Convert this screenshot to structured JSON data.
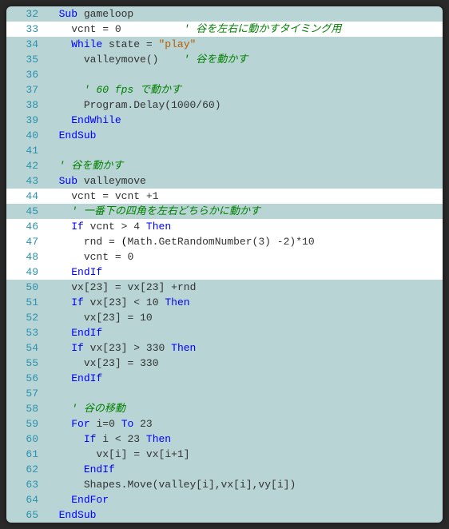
{
  "lines": [
    {
      "n": 32,
      "hl": false,
      "tokens": [
        {
          "t": "  ",
          "c": "plain"
        },
        {
          "t": "Sub",
          "c": "kw"
        },
        {
          "t": " ",
          "c": "plain"
        },
        {
          "t": "gameloop",
          "c": "ident"
        }
      ]
    },
    {
      "n": 33,
      "hl": true,
      "tokens": [
        {
          "t": "    ",
          "c": "plain"
        },
        {
          "t": "vcnt",
          "c": "ident"
        },
        {
          "t": " ",
          "c": "plain"
        },
        {
          "t": "=",
          "c": "op"
        },
        {
          "t": " ",
          "c": "plain"
        },
        {
          "t": "0",
          "c": "num"
        },
        {
          "t": "          ",
          "c": "plain"
        },
        {
          "t": "' 谷を左右に動かすタイミング用",
          "c": "comment"
        }
      ]
    },
    {
      "n": 34,
      "hl": false,
      "tokens": [
        {
          "t": "    ",
          "c": "plain"
        },
        {
          "t": "While",
          "c": "kw"
        },
        {
          "t": " ",
          "c": "plain"
        },
        {
          "t": "state",
          "c": "ident"
        },
        {
          "t": " ",
          "c": "plain"
        },
        {
          "t": "=",
          "c": "op"
        },
        {
          "t": " ",
          "c": "plain"
        },
        {
          "t": "\"play\"",
          "c": "str"
        }
      ]
    },
    {
      "n": 35,
      "hl": false,
      "tokens": [
        {
          "t": "      ",
          "c": "plain"
        },
        {
          "t": "valleymove",
          "c": "ident"
        },
        {
          "t": "()",
          "c": "op"
        },
        {
          "t": "    ",
          "c": "plain"
        },
        {
          "t": "' 谷を動かす",
          "c": "comment"
        }
      ]
    },
    {
      "n": 36,
      "hl": false,
      "tokens": []
    },
    {
      "n": 37,
      "hl": false,
      "tokens": [
        {
          "t": "      ",
          "c": "plain"
        },
        {
          "t": "' 60 fps で動かす",
          "c": "comment"
        }
      ]
    },
    {
      "n": 38,
      "hl": false,
      "tokens": [
        {
          "t": "      ",
          "c": "plain"
        },
        {
          "t": "Program",
          "c": "ident"
        },
        {
          "t": ".",
          "c": "op"
        },
        {
          "t": "Delay",
          "c": "ident"
        },
        {
          "t": "(",
          "c": "op"
        },
        {
          "t": "1000",
          "c": "num"
        },
        {
          "t": "/",
          "c": "op"
        },
        {
          "t": "60",
          "c": "num"
        },
        {
          "t": ")",
          "c": "op"
        }
      ]
    },
    {
      "n": 39,
      "hl": false,
      "tokens": [
        {
          "t": "    ",
          "c": "plain"
        },
        {
          "t": "EndWhile",
          "c": "kw"
        }
      ]
    },
    {
      "n": 40,
      "hl": false,
      "tokens": [
        {
          "t": "  ",
          "c": "plain"
        },
        {
          "t": "EndSub",
          "c": "kw"
        }
      ]
    },
    {
      "n": 41,
      "hl": false,
      "tokens": []
    },
    {
      "n": 42,
      "hl": false,
      "tokens": [
        {
          "t": "  ",
          "c": "plain"
        },
        {
          "t": "' 谷を動かす",
          "c": "comment"
        }
      ]
    },
    {
      "n": 43,
      "hl": false,
      "tokens": [
        {
          "t": "  ",
          "c": "plain"
        },
        {
          "t": "Sub",
          "c": "kw"
        },
        {
          "t": " ",
          "c": "plain"
        },
        {
          "t": "valleymove",
          "c": "ident"
        }
      ]
    },
    {
      "n": 44,
      "hl": true,
      "tokens": [
        {
          "t": "    ",
          "c": "plain"
        },
        {
          "t": "vcnt",
          "c": "ident"
        },
        {
          "t": " ",
          "c": "plain"
        },
        {
          "t": "=",
          "c": "op"
        },
        {
          "t": " ",
          "c": "plain"
        },
        {
          "t": "vcnt",
          "c": "ident"
        },
        {
          "t": " ",
          "c": "plain"
        },
        {
          "t": "+",
          "c": "op"
        },
        {
          "t": "1",
          "c": "num"
        }
      ]
    },
    {
      "n": 45,
      "hl": false,
      "tokens": [
        {
          "t": "    ",
          "c": "plain"
        },
        {
          "t": "' 一番下の四角を左右どちらかに動かす",
          "c": "comment"
        }
      ]
    },
    {
      "n": 46,
      "hl": true,
      "tokens": [
        {
          "t": "    ",
          "c": "plain"
        },
        {
          "t": "If",
          "c": "kw"
        },
        {
          "t": " ",
          "c": "plain"
        },
        {
          "t": "vcnt",
          "c": "ident"
        },
        {
          "t": " ",
          "c": "plain"
        },
        {
          "t": ">",
          "c": "op"
        },
        {
          "t": " ",
          "c": "plain"
        },
        {
          "t": "4",
          "c": "num"
        },
        {
          "t": " ",
          "c": "plain"
        },
        {
          "t": "Then",
          "c": "kw"
        }
      ]
    },
    {
      "n": 47,
      "hl": true,
      "tokens": [
        {
          "t": "      ",
          "c": "plain"
        },
        {
          "t": "rnd",
          "c": "ident"
        },
        {
          "t": " ",
          "c": "plain"
        },
        {
          "t": "=",
          "c": "op"
        },
        {
          "t": " (",
          "c": "plain"
        },
        {
          "t": "Math",
          "c": "ident"
        },
        {
          "t": ".",
          "c": "op"
        },
        {
          "t": "GetRandomNumber",
          "c": "ident"
        },
        {
          "t": "(",
          "c": "op"
        },
        {
          "t": "3",
          "c": "num"
        },
        {
          "t": ")",
          "c": "op"
        },
        {
          "t": " ",
          "c": "plain"
        },
        {
          "t": "-",
          "c": "op"
        },
        {
          "t": "2",
          "c": "num"
        },
        {
          "t": ")",
          "c": "op"
        },
        {
          "t": "*",
          "c": "op"
        },
        {
          "t": "10",
          "c": "num"
        }
      ]
    },
    {
      "n": 48,
      "hl": true,
      "tokens": [
        {
          "t": "      ",
          "c": "plain"
        },
        {
          "t": "vcnt",
          "c": "ident"
        },
        {
          "t": " ",
          "c": "plain"
        },
        {
          "t": "=",
          "c": "op"
        },
        {
          "t": " ",
          "c": "plain"
        },
        {
          "t": "0",
          "c": "num"
        }
      ]
    },
    {
      "n": 49,
      "hl": true,
      "tokens": [
        {
          "t": "    ",
          "c": "plain"
        },
        {
          "t": "EndIf",
          "c": "kw"
        }
      ]
    },
    {
      "n": 50,
      "hl": false,
      "tokens": [
        {
          "t": "    ",
          "c": "plain"
        },
        {
          "t": "vx",
          "c": "ident"
        },
        {
          "t": "[",
          "c": "op"
        },
        {
          "t": "23",
          "c": "num"
        },
        {
          "t": "]",
          "c": "op"
        },
        {
          "t": " ",
          "c": "plain"
        },
        {
          "t": "=",
          "c": "op"
        },
        {
          "t": " ",
          "c": "plain"
        },
        {
          "t": "vx",
          "c": "ident"
        },
        {
          "t": "[",
          "c": "op"
        },
        {
          "t": "23",
          "c": "num"
        },
        {
          "t": "]",
          "c": "op"
        },
        {
          "t": " ",
          "c": "plain"
        },
        {
          "t": "+",
          "c": "op"
        },
        {
          "t": "rnd",
          "c": "ident"
        }
      ]
    },
    {
      "n": 51,
      "hl": false,
      "tokens": [
        {
          "t": "    ",
          "c": "plain"
        },
        {
          "t": "If",
          "c": "kw"
        },
        {
          "t": " ",
          "c": "plain"
        },
        {
          "t": "vx",
          "c": "ident"
        },
        {
          "t": "[",
          "c": "op"
        },
        {
          "t": "23",
          "c": "num"
        },
        {
          "t": "]",
          "c": "op"
        },
        {
          "t": " ",
          "c": "plain"
        },
        {
          "t": "<",
          "c": "op"
        },
        {
          "t": " ",
          "c": "plain"
        },
        {
          "t": "10",
          "c": "num"
        },
        {
          "t": " ",
          "c": "plain"
        },
        {
          "t": "Then",
          "c": "kw"
        }
      ]
    },
    {
      "n": 52,
      "hl": false,
      "tokens": [
        {
          "t": "      ",
          "c": "plain"
        },
        {
          "t": "vx",
          "c": "ident"
        },
        {
          "t": "[",
          "c": "op"
        },
        {
          "t": "23",
          "c": "num"
        },
        {
          "t": "]",
          "c": "op"
        },
        {
          "t": " ",
          "c": "plain"
        },
        {
          "t": "=",
          "c": "op"
        },
        {
          "t": " ",
          "c": "plain"
        },
        {
          "t": "10",
          "c": "num"
        }
      ]
    },
    {
      "n": 53,
      "hl": false,
      "tokens": [
        {
          "t": "    ",
          "c": "plain"
        },
        {
          "t": "EndIf",
          "c": "kw"
        }
      ]
    },
    {
      "n": 54,
      "hl": false,
      "tokens": [
        {
          "t": "    ",
          "c": "plain"
        },
        {
          "t": "If",
          "c": "kw"
        },
        {
          "t": " ",
          "c": "plain"
        },
        {
          "t": "vx",
          "c": "ident"
        },
        {
          "t": "[",
          "c": "op"
        },
        {
          "t": "23",
          "c": "num"
        },
        {
          "t": "]",
          "c": "op"
        },
        {
          "t": " ",
          "c": "plain"
        },
        {
          "t": ">",
          "c": "op"
        },
        {
          "t": " ",
          "c": "plain"
        },
        {
          "t": "330",
          "c": "num"
        },
        {
          "t": " ",
          "c": "plain"
        },
        {
          "t": "Then",
          "c": "kw"
        }
      ]
    },
    {
      "n": 55,
      "hl": false,
      "tokens": [
        {
          "t": "      ",
          "c": "plain"
        },
        {
          "t": "vx",
          "c": "ident"
        },
        {
          "t": "[",
          "c": "op"
        },
        {
          "t": "23",
          "c": "num"
        },
        {
          "t": "]",
          "c": "op"
        },
        {
          "t": " ",
          "c": "plain"
        },
        {
          "t": "=",
          "c": "op"
        },
        {
          "t": " ",
          "c": "plain"
        },
        {
          "t": "330",
          "c": "num"
        }
      ]
    },
    {
      "n": 56,
      "hl": false,
      "tokens": [
        {
          "t": "    ",
          "c": "plain"
        },
        {
          "t": "EndIf",
          "c": "kw"
        }
      ]
    },
    {
      "n": 57,
      "hl": false,
      "tokens": []
    },
    {
      "n": 58,
      "hl": false,
      "tokens": [
        {
          "t": "    ",
          "c": "plain"
        },
        {
          "t": "' 谷の移動",
          "c": "comment"
        }
      ]
    },
    {
      "n": 59,
      "hl": false,
      "tokens": [
        {
          "t": "    ",
          "c": "plain"
        },
        {
          "t": "For",
          "c": "kw"
        },
        {
          "t": " ",
          "c": "plain"
        },
        {
          "t": "i",
          "c": "ident"
        },
        {
          "t": "=",
          "c": "op"
        },
        {
          "t": "0",
          "c": "num"
        },
        {
          "t": " ",
          "c": "plain"
        },
        {
          "t": "To",
          "c": "kw"
        },
        {
          "t": " ",
          "c": "plain"
        },
        {
          "t": "23",
          "c": "num"
        }
      ]
    },
    {
      "n": 60,
      "hl": false,
      "tokens": [
        {
          "t": "      ",
          "c": "plain"
        },
        {
          "t": "If",
          "c": "kw"
        },
        {
          "t": " ",
          "c": "plain"
        },
        {
          "t": "i",
          "c": "ident"
        },
        {
          "t": " ",
          "c": "plain"
        },
        {
          "t": "<",
          "c": "op"
        },
        {
          "t": " ",
          "c": "plain"
        },
        {
          "t": "23",
          "c": "num"
        },
        {
          "t": " ",
          "c": "plain"
        },
        {
          "t": "Then",
          "c": "kw"
        }
      ]
    },
    {
      "n": 61,
      "hl": false,
      "tokens": [
        {
          "t": "        ",
          "c": "plain"
        },
        {
          "t": "vx",
          "c": "ident"
        },
        {
          "t": "[",
          "c": "op"
        },
        {
          "t": "i",
          "c": "ident"
        },
        {
          "t": "]",
          "c": "op"
        },
        {
          "t": " ",
          "c": "plain"
        },
        {
          "t": "=",
          "c": "op"
        },
        {
          "t": " ",
          "c": "plain"
        },
        {
          "t": "vx",
          "c": "ident"
        },
        {
          "t": "[",
          "c": "op"
        },
        {
          "t": "i",
          "c": "ident"
        },
        {
          "t": "+",
          "c": "op"
        },
        {
          "t": "1",
          "c": "num"
        },
        {
          "t": "]",
          "c": "op"
        }
      ]
    },
    {
      "n": 62,
      "hl": false,
      "tokens": [
        {
          "t": "      ",
          "c": "plain"
        },
        {
          "t": "EndIf",
          "c": "kw"
        }
      ]
    },
    {
      "n": 63,
      "hl": false,
      "tokens": [
        {
          "t": "      ",
          "c": "plain"
        },
        {
          "t": "Shapes",
          "c": "ident"
        },
        {
          "t": ".",
          "c": "op"
        },
        {
          "t": "Move",
          "c": "ident"
        },
        {
          "t": "(",
          "c": "op"
        },
        {
          "t": "valley",
          "c": "ident"
        },
        {
          "t": "[",
          "c": "op"
        },
        {
          "t": "i",
          "c": "ident"
        },
        {
          "t": "]",
          "c": "op"
        },
        {
          "t": ",",
          "c": "op"
        },
        {
          "t": "vx",
          "c": "ident"
        },
        {
          "t": "[",
          "c": "op"
        },
        {
          "t": "i",
          "c": "ident"
        },
        {
          "t": "]",
          "c": "op"
        },
        {
          "t": ",",
          "c": "op"
        },
        {
          "t": "vy",
          "c": "ident"
        },
        {
          "t": "[",
          "c": "op"
        },
        {
          "t": "i",
          "c": "ident"
        },
        {
          "t": "]",
          "c": "op"
        },
        {
          "t": ")",
          "c": "op"
        }
      ]
    },
    {
      "n": 64,
      "hl": false,
      "tokens": [
        {
          "t": "    ",
          "c": "plain"
        },
        {
          "t": "EndFor",
          "c": "kw"
        }
      ]
    },
    {
      "n": 65,
      "hl": false,
      "tokens": [
        {
          "t": "  ",
          "c": "plain"
        },
        {
          "t": "EndSub",
          "c": "kw"
        }
      ]
    }
  ]
}
